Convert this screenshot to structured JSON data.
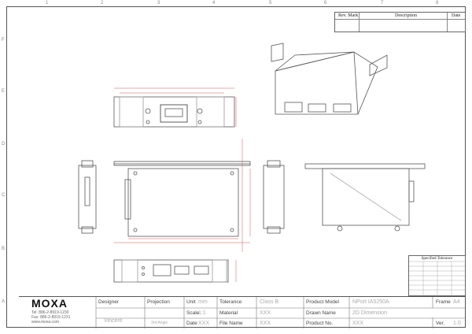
{
  "col_ticks": [
    "1",
    "2",
    "3",
    "4",
    "5",
    "6",
    "7",
    "8"
  ],
  "row_ticks": [
    "F",
    "E",
    "D",
    "C",
    "B",
    "A"
  ],
  "revision": {
    "mark_label": "Rev. Mark",
    "description_label": "Description",
    "date_label": "Date"
  },
  "tolerance_table": {
    "title": "Specified Tolerance"
  },
  "title_block": {
    "logo": "MOXA",
    "contact_tel": "Tel: 886-2-8919-1230",
    "contact_fax": "Fax: 886-2-8919-1231",
    "contact_web": "www.moxa.com",
    "designer_label": "Designer",
    "designer_value": "Vincent",
    "projection_label": "Projection",
    "projection_value": "3rd Angle",
    "unit_label": "Unit",
    "unit_value": "mm",
    "scale_label": "Scale",
    "scale_value": "1:1",
    "date_label": "Date",
    "date_value": "XXX",
    "tolerance_label": "Tolerance",
    "tolerance_value": "Class B",
    "material_label": "Material",
    "material_value": "XXX",
    "filename_label": "File Name",
    "filename_value": "XXX",
    "product_model_label": "Product Model",
    "product_model_value": "NPort IA5250A",
    "drawn_name_label": "Drawn Name",
    "drawn_name_value": "2D Dimension",
    "product_no_label": "Product No.",
    "product_no_value": "XXX",
    "frame_label": "Frame",
    "frame_value": "A4",
    "ver_label": "Ver.",
    "ver_value": "1.0"
  }
}
